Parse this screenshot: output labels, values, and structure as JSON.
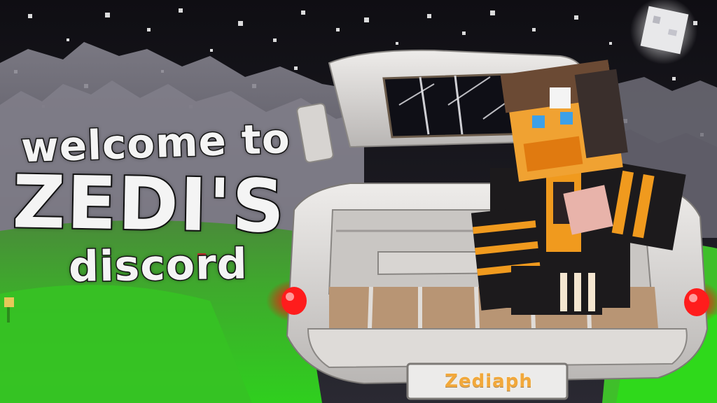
{
  "banner": {
    "line1": "welcome to",
    "line2": "ZEDI'S",
    "line3": "discord"
  },
  "plate": {
    "text": "Zediaph"
  },
  "colors": {
    "sky": "#141319",
    "grass": "#3fbf2a",
    "car_body": "#d9d6d4",
    "tail_light": "#ff2020",
    "plate_text": "#f2a83a",
    "hoodie_orange": "#f09a1e"
  },
  "icons": {
    "moon": "moon-icon",
    "flower": "flower-icon"
  }
}
